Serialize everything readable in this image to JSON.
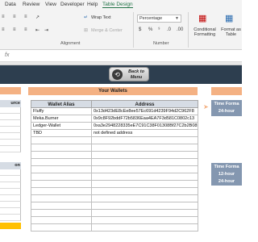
{
  "ribbon": {
    "tabs": [
      "Data",
      "Review",
      "View",
      "Developer",
      "Help",
      "Table Design"
    ],
    "active_tab_index": 5,
    "wrap_text_label": "Wrap Text",
    "merge_center_label": "Merge & Center",
    "alignment_group": "Alignment",
    "number_group": "Number",
    "number_format": "Percentage",
    "conditional_formatting_label": "Conditional Formatting",
    "format_as_table_label": "Format as Table",
    "accent_color": "#217346"
  },
  "nav": {
    "back_label_line1": "Back to",
    "back_label_line2": "Menu",
    "band_color": "#2d3e4f"
  },
  "left": {
    "sub1": "urce",
    "sub2": "on"
  },
  "wallets": {
    "title": "Your Wallets",
    "col_alias": "Wallet Alias",
    "col_address": "Address",
    "rows": [
      {
        "alias": "Fluffy",
        "address": "0x13d423dE8cEe8ee57Ec691d4239F94d2C962F8"
      },
      {
        "alias": "Meka.Burner",
        "address": "0x9c8F92bddF72b5836Eaa4EA7F3d581C0802c13"
      },
      {
        "alias": "Ledger-Wallet",
        "address": "0xa3e2948228335eE7C91C38F01308Bf27C2b2B0855"
      },
      {
        "alias": "TBD",
        "address": "not defined address"
      }
    ],
    "header_color": "#f4b183",
    "subheader_color": "#d6dce4"
  },
  "right": {
    "box1_title": "Time Forma",
    "box1_value": "24-hour",
    "box2_title": "Time Forma",
    "box2_values": [
      "12-hour",
      "24-hour"
    ],
    "box_color": "#8497b0"
  }
}
